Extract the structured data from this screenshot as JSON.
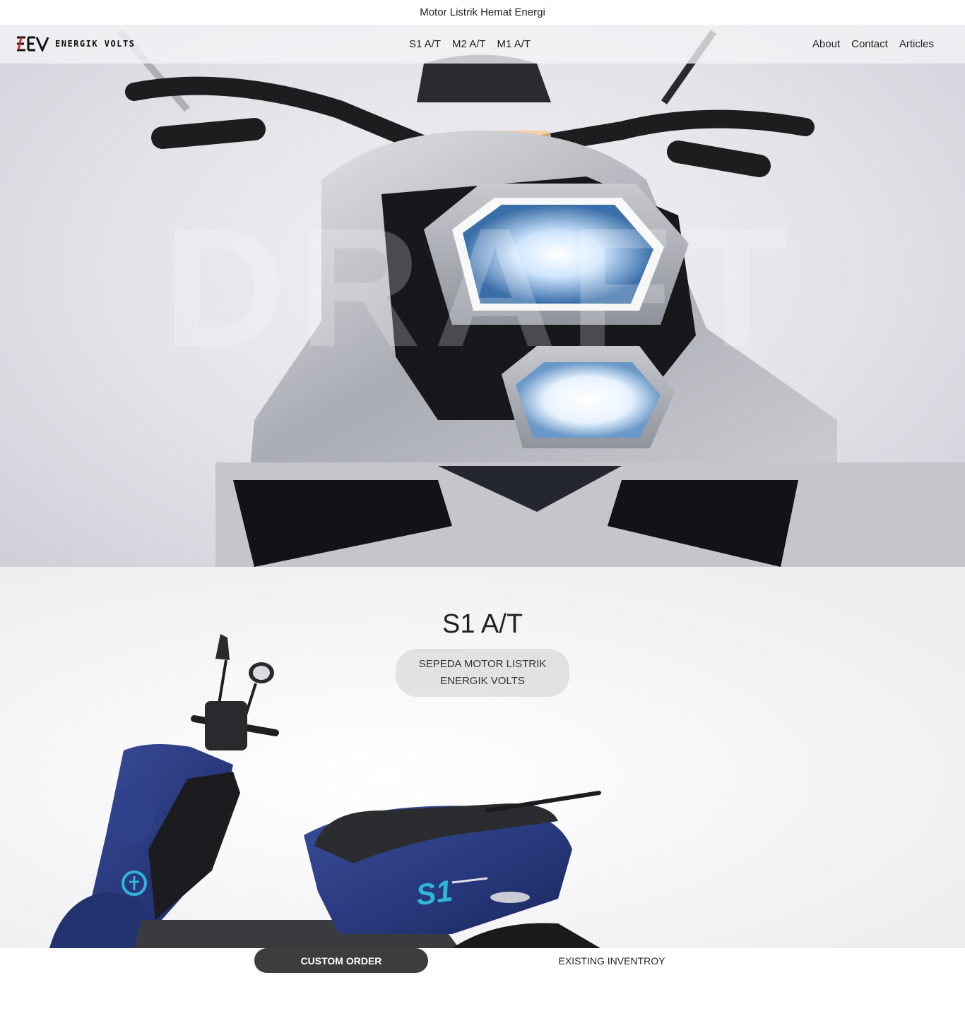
{
  "announcement": {
    "text": "Motor Listrik Hemat Energi"
  },
  "brand": {
    "logo_text": "ENERGIK VOLTS"
  },
  "nav": {
    "models": [
      {
        "label": "S1 A/T"
      },
      {
        "label": "M2 A/T"
      },
      {
        "label": "M1 A/T"
      }
    ],
    "links": [
      {
        "label": "About"
      },
      {
        "label": "Contact"
      },
      {
        "label": "Articles"
      }
    ]
  },
  "hero": {
    "watermark": "DRAFT"
  },
  "model": {
    "title": "S1 A/T",
    "subtitle": "SEPEDA MOTOR LISTRIK ENERGIK VOLTS",
    "decal": "S1"
  },
  "actions": {
    "primary": "CUSTOM ORDER",
    "secondary": "EXISTING INVENTROY"
  },
  "colors": {
    "accent_dark": "#3d3d3d",
    "scooter_blue": "#27377a",
    "decal_cyan": "#2fb6d9",
    "logo_red": "#d42a2a"
  }
}
